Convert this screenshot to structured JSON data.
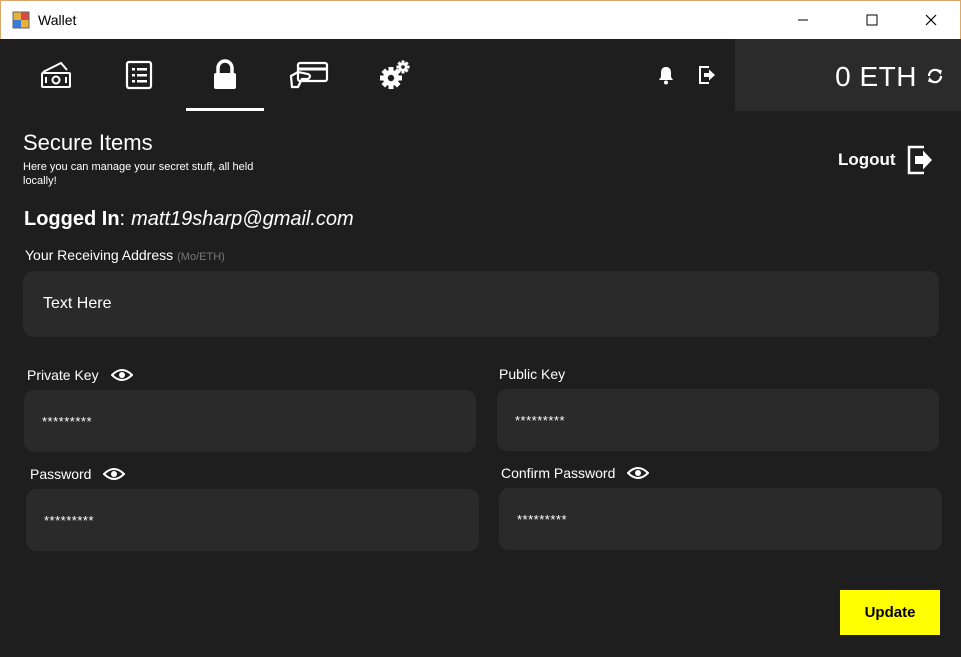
{
  "window": {
    "title": "Wallet"
  },
  "nav": {
    "tabs": [
      {
        "id": "wallet",
        "icon": "money-icon"
      },
      {
        "id": "transactions",
        "icon": "list-icon"
      },
      {
        "id": "secure",
        "icon": "lock-icon",
        "active": true
      },
      {
        "id": "cards",
        "icon": "card-icon"
      },
      {
        "id": "settings",
        "icon": "gears-icon"
      }
    ],
    "balance": "0 ETH"
  },
  "secure": {
    "title": "Secure Items",
    "description": "Here you can manage your secret stuff, all held locally!",
    "logout_label": "Logout",
    "logged_in_label": "Logged In",
    "logged_in_colon": ":",
    "email": "matt19sharp@gmail.com",
    "receiving_address": {
      "label": "Your Receiving Address",
      "hint": "(Mo/ETH)",
      "value": "Text Here"
    },
    "private_key": {
      "label": "Private Key",
      "value": "*********"
    },
    "public_key": {
      "label": "Public Key",
      "value": "*********"
    },
    "password": {
      "label": "Password",
      "value": "*********"
    },
    "confirm_password": {
      "label": "Confirm Password",
      "value": "*********"
    },
    "update_label": "Update"
  },
  "colors": {
    "background": "#1e1e1e",
    "field": "#2a2a2a",
    "balance_panel": "#2b2b2b",
    "accent": "#ffff00"
  }
}
